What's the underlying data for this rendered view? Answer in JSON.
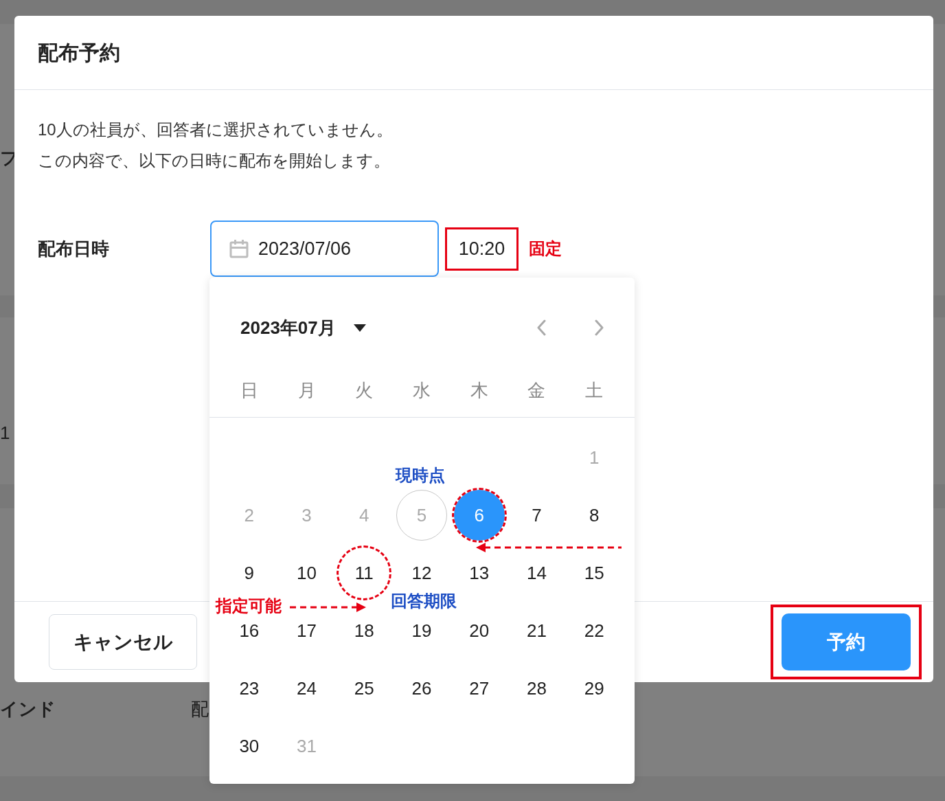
{
  "background": {
    "sections": [
      {
        "cells": [
          {
            "kind": "label",
            "text": "フ"
          }
        ]
      },
      {
        "cells": [
          {
            "kind": "value",
            "text": "1"
          }
        ]
      },
      {
        "cells": [
          {
            "kind": "label",
            "text": "インド"
          },
          {
            "kind": "value",
            "text": "配"
          }
        ]
      }
    ]
  },
  "dialog": {
    "title": "配布予約",
    "message": [
      "10人の社員が、回答者に選択されていません。",
      "この内容で、以下の日時に配布を開始します。"
    ],
    "field_label": "配布日時",
    "date": {
      "value": "2023/07/06"
    },
    "time": {
      "value": "10:20",
      "highlighted": true,
      "note": "固定"
    },
    "buttons": [
      {
        "kind": "secondary",
        "label": "キャンセル",
        "highlighted": false
      },
      {
        "kind": "primary",
        "label": "予約",
        "highlighted": true
      }
    ]
  },
  "calendar": {
    "month_label": "2023年07月",
    "weekdays": [
      "日",
      "月",
      "火",
      "水",
      "木",
      "金",
      "土"
    ],
    "weeks": [
      {
        "kind": "lead",
        "days": [
          {
            "label": "1",
            "disabled": true,
            "today": false,
            "selected": false,
            "circled": false
          }
        ]
      },
      {
        "kind": "full",
        "days": [
          {
            "label": "2",
            "disabled": true,
            "today": false,
            "selected": false,
            "circled": false
          },
          {
            "label": "3",
            "disabled": true,
            "today": false,
            "selected": false,
            "circled": false
          },
          {
            "label": "4",
            "disabled": true,
            "today": false,
            "selected": false,
            "circled": false
          },
          {
            "label": "5",
            "disabled": true,
            "today": true,
            "selected": false,
            "circled": false
          },
          {
            "label": "6",
            "disabled": false,
            "today": false,
            "selected": true,
            "circled": true
          },
          {
            "label": "7",
            "disabled": false,
            "today": false,
            "selected": false,
            "circled": false
          },
          {
            "label": "8",
            "disabled": false,
            "today": false,
            "selected": false,
            "circled": false
          }
        ]
      },
      {
        "kind": "full",
        "days": [
          {
            "label": "9",
            "disabled": false,
            "today": false,
            "selected": false,
            "circled": false
          },
          {
            "label": "10",
            "disabled": false,
            "today": false,
            "selected": false,
            "circled": false
          },
          {
            "label": "11",
            "disabled": false,
            "today": false,
            "selected": false,
            "circled": true
          },
          {
            "label": "12",
            "disabled": false,
            "today": false,
            "selected": false,
            "circled": false
          },
          {
            "label": "13",
            "disabled": false,
            "today": false,
            "selected": false,
            "circled": false
          },
          {
            "label": "14",
            "disabled": false,
            "today": false,
            "selected": false,
            "circled": false
          },
          {
            "label": "15",
            "disabled": false,
            "today": false,
            "selected": false,
            "circled": false
          }
        ]
      },
      {
        "kind": "full",
        "days": [
          {
            "label": "16",
            "disabled": false,
            "today": false,
            "selected": false,
            "circled": false
          },
          {
            "label": "17",
            "disabled": false,
            "today": false,
            "selected": false,
            "circled": false
          },
          {
            "label": "18",
            "disabled": false,
            "today": false,
            "selected": false,
            "circled": false
          },
          {
            "label": "19",
            "disabled": false,
            "today": false,
            "selected": false,
            "circled": false
          },
          {
            "label": "20",
            "disabled": false,
            "today": false,
            "selected": false,
            "circled": false
          },
          {
            "label": "21",
            "disabled": false,
            "today": false,
            "selected": false,
            "circled": false
          },
          {
            "label": "22",
            "disabled": false,
            "today": false,
            "selected": false,
            "circled": false
          }
        ]
      },
      {
        "kind": "full",
        "days": [
          {
            "label": "23",
            "disabled": false,
            "today": false,
            "selected": false,
            "circled": false
          },
          {
            "label": "24",
            "disabled": false,
            "today": false,
            "selected": false,
            "circled": false
          },
          {
            "label": "25",
            "disabled": false,
            "today": false,
            "selected": false,
            "circled": false
          },
          {
            "label": "26",
            "disabled": false,
            "today": false,
            "selected": false,
            "circled": false
          },
          {
            "label": "27",
            "disabled": false,
            "today": false,
            "selected": false,
            "circled": false
          },
          {
            "label": "28",
            "disabled": false,
            "today": false,
            "selected": false,
            "circled": false
          },
          {
            "label": "29",
            "disabled": false,
            "today": false,
            "selected": false,
            "circled": false
          }
        ]
      },
      {
        "kind": "tail",
        "days": [
          {
            "label": "30",
            "disabled": false,
            "today": false,
            "selected": false,
            "circled": false
          },
          {
            "label": "31",
            "disabled": true,
            "today": false,
            "selected": false,
            "circled": false
          }
        ]
      }
    ],
    "annotations": [
      {
        "kind": "now",
        "text": "現時点",
        "color": "#1d4ec4"
      },
      {
        "kind": "deadline",
        "text": "回答期限",
        "color": "#1d4ec4"
      },
      {
        "kind": "range",
        "text": "指定可能",
        "color": "#e60012"
      }
    ]
  }
}
